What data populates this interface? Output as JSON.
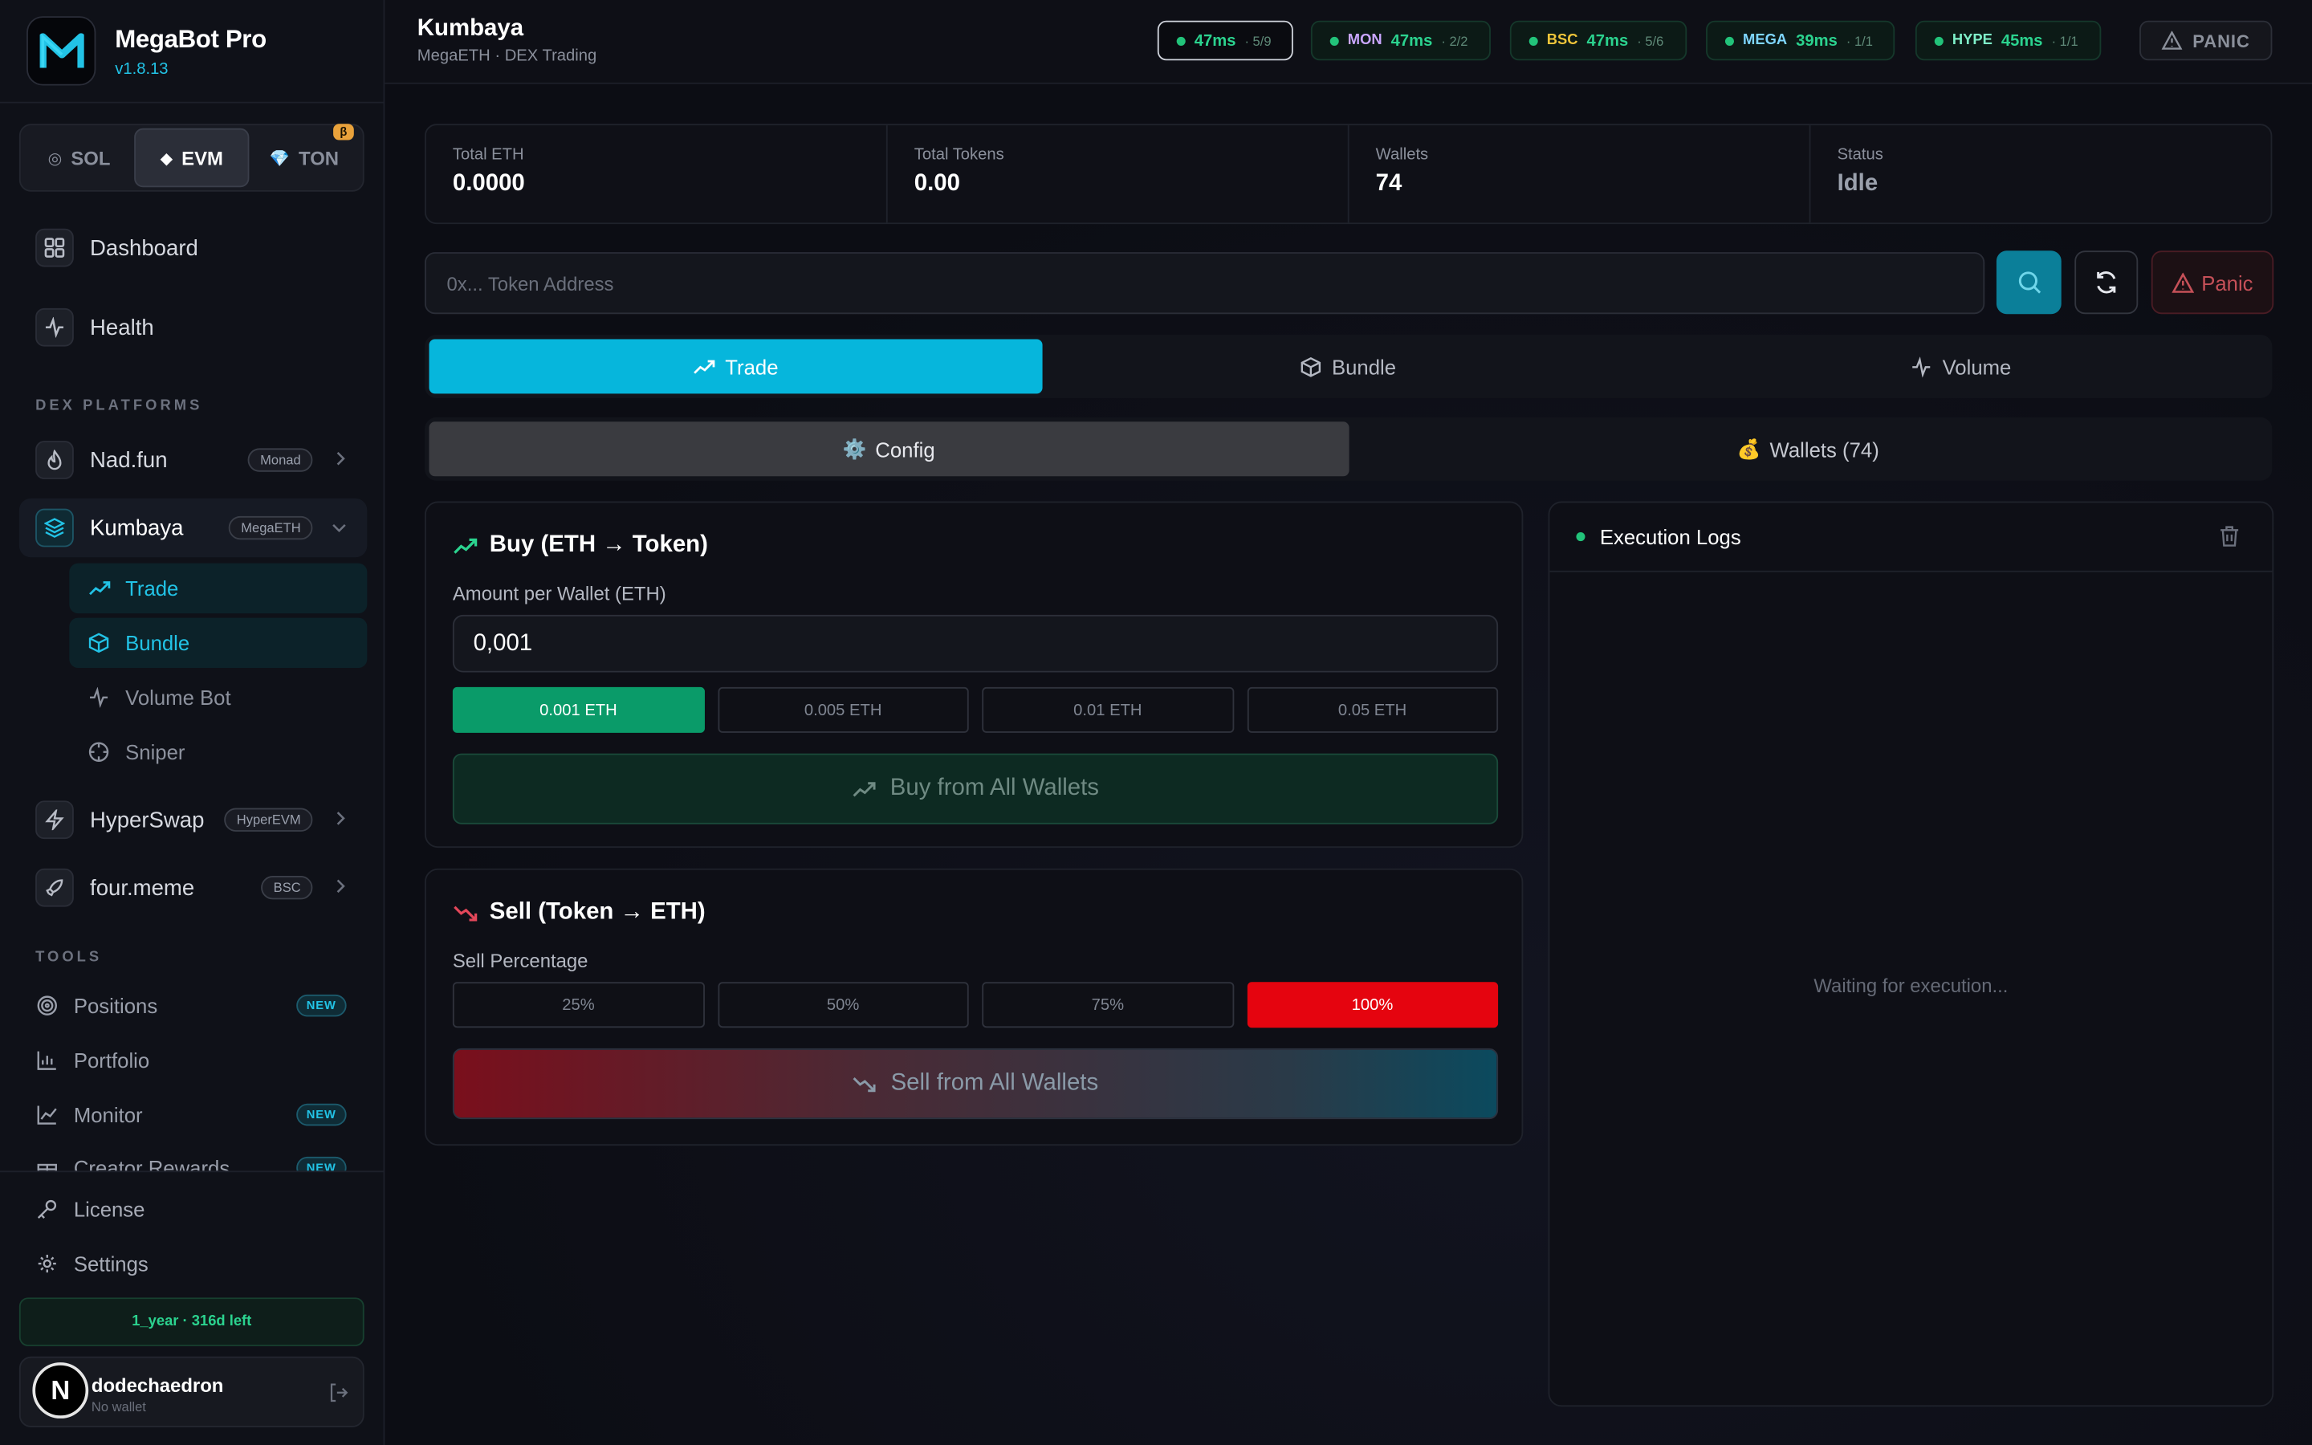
{
  "brand": {
    "name": "MegaBot Pro",
    "version": "v1.8.13"
  },
  "chains": [
    {
      "label": "SOL",
      "glyph": "◎"
    },
    {
      "label": "EVM",
      "glyph": "◆"
    },
    {
      "label": "TON",
      "glyph": "💎",
      "badge": "β"
    }
  ],
  "nav": {
    "dashboard": "Dashboard",
    "health": "Health",
    "section_dex": "DEX PLATFORMS",
    "section_tools": "TOOLS",
    "platforms": [
      {
        "label": "Nad.fun",
        "chip": "Monad"
      },
      {
        "label": "Kumbaya",
        "chip": "MegaETH"
      },
      {
        "label": "HyperSwap",
        "chip": "HyperEVM"
      },
      {
        "label": "four.meme",
        "chip": "BSC"
      }
    ],
    "kumbaya_sub": [
      "Trade",
      "Bundle",
      "Volume Bot",
      "Sniper"
    ],
    "tools": [
      {
        "label": "Positions",
        "badge": "NEW"
      },
      {
        "label": "Portfolio"
      },
      {
        "label": "Monitor",
        "badge": "NEW"
      },
      {
        "label": "Creator Rewards",
        "badge": "NEW"
      }
    ],
    "license": "License",
    "settings": "Settings"
  },
  "license_status": "1_year · 316d left",
  "user": {
    "avatar_letter": "N",
    "name": "dodechaedron",
    "wallet": "No wallet"
  },
  "header": {
    "title": "Kumbaya",
    "subtitle": "MegaETH · DEX Trading",
    "latency": [
      {
        "name": "",
        "ms": "47ms",
        "count": "· 5/9"
      },
      {
        "name": "MON",
        "ms": "47ms",
        "count": "· 2/2",
        "color": "#c9a6ff"
      },
      {
        "name": "BSC",
        "ms": "47ms",
        "count": "· 5/6",
        "color": "#f0c53a"
      },
      {
        "name": "MEGA",
        "ms": "39ms",
        "count": "· 1/1",
        "color": "#7fd6ff"
      },
      {
        "name": "HYPE",
        "ms": "45ms",
        "count": "· 1/1",
        "color": "#7ff0c9"
      }
    ],
    "panic": "PANIC"
  },
  "stats": [
    {
      "label": "Total ETH",
      "value": "0.0000"
    },
    {
      "label": "Total Tokens",
      "value": "0.00"
    },
    {
      "label": "Wallets",
      "value": "74"
    },
    {
      "label": "Status",
      "value": "Idle"
    }
  ],
  "search": {
    "placeholder": "0x... Token Address",
    "panic_label": "Panic"
  },
  "mode_tabs": [
    "Trade",
    "Bundle",
    "Volume"
  ],
  "sub_tabs": [
    {
      "label": "Config",
      "glyph": "⚙️"
    },
    {
      "label": "Wallets (74)",
      "glyph": "💰"
    }
  ],
  "buy": {
    "title": "Buy (ETH → Token)",
    "amount_label": "Amount per Wallet (ETH)",
    "amount_value": "0,001",
    "presets": [
      "0.001 ETH",
      "0.005 ETH",
      "0.01 ETH",
      "0.05 ETH"
    ],
    "button": "Buy from All Wallets"
  },
  "sell": {
    "title": "Sell (Token → ETH)",
    "percent_label": "Sell Percentage",
    "presets": [
      "25%",
      "50%",
      "75%",
      "100%"
    ],
    "button": "Sell from All Wallets"
  },
  "logs": {
    "title": "Execution Logs",
    "empty": "Waiting for execution..."
  },
  "colors": {
    "accent": "#06b6dc",
    "buy": "#0a9b69",
    "sell": "#e5040f",
    "ok": "#2bd38f"
  }
}
